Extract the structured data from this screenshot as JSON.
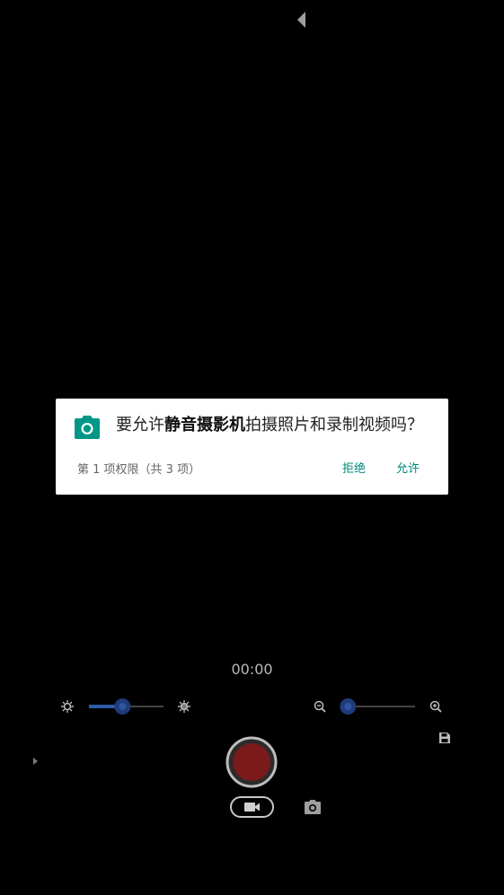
{
  "dialog": {
    "question_prefix": "要允许",
    "app_name": "静音摄影机",
    "question_suffix": "拍摄照片和录制视频吗？",
    "counter": "第 1 项权限（共 3 项）",
    "deny_label": "拒绝",
    "allow_label": "允许",
    "accent_color": "#00897B",
    "icon": "camera-icon"
  },
  "camera": {
    "timer": "00:00",
    "exposure_level": 0.45,
    "zoom_level": 0.1,
    "record_color": "#7a1a1a",
    "mode": "video"
  },
  "icons": {
    "back": "back-arrow-icon",
    "brightness_low": "brightness-low-icon",
    "brightness_high": "brightness-high-icon",
    "zoom_out": "zoom-out-icon",
    "zoom_in": "zoom-in-icon",
    "save": "save-icon",
    "expand": "expand-arrow-icon",
    "video": "video-camera-icon",
    "photo": "photo-camera-icon"
  }
}
